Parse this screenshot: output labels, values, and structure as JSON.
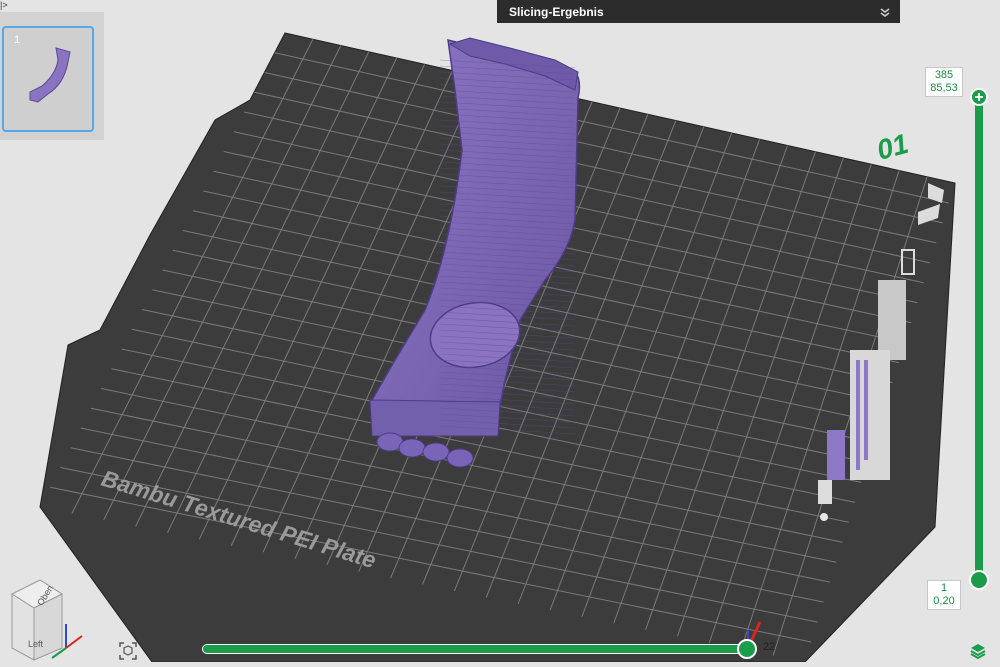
{
  "top_corner_mark": "|>",
  "objects_panel": {
    "plate_number": "1"
  },
  "result_panel": {
    "title": "Slicing-Ergebnis"
  },
  "build_plate": {
    "label": "Bambu Textured PEI Plate",
    "plate_id": "01"
  },
  "layer_slider": {
    "top_layer": "385",
    "top_height": "85,53",
    "bottom_layer": "1",
    "bottom_height": "0,20"
  },
  "move_slider": {
    "value": "22"
  },
  "view_cube": {
    "top_face": "Oben",
    "left_face": "Left"
  },
  "colors": {
    "accent": "#1a9c4a",
    "plate": "#3c3c3c",
    "grid": "#7a7a7a",
    "model": "#7f68b6",
    "selection": "#58a7e6"
  },
  "icons": {
    "collapse": "double-chevron-down-icon",
    "fit_view": "fit-view-icon",
    "layers": "layers-icon",
    "add_layer": "plus-icon"
  }
}
